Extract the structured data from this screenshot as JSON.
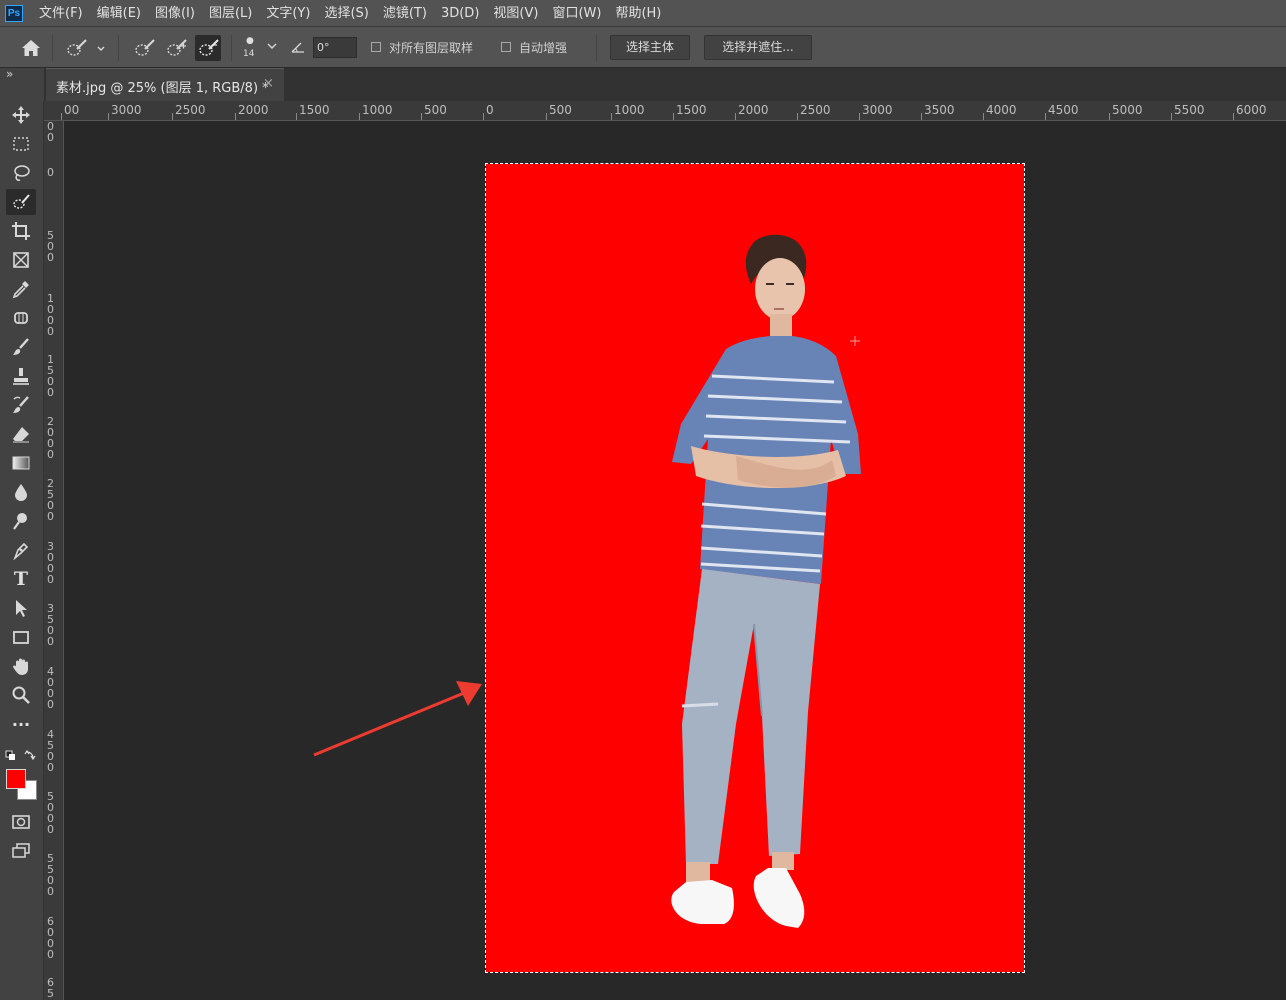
{
  "app": {
    "logo_text": "Ps",
    "accent_color": "#31a8ff"
  },
  "menu": {
    "items": [
      "文件(F)",
      "编辑(E)",
      "图像(I)",
      "图层(L)",
      "文字(Y)",
      "选择(S)",
      "滤镜(T)",
      "3D(D)",
      "视图(V)",
      "窗口(W)",
      "帮助(H)"
    ]
  },
  "options_bar": {
    "brush_size": "14",
    "angle_value": "0°",
    "sample_all_layers_label": "对所有图层取样",
    "sample_all_layers_checked": false,
    "auto_enhance_label": "自动增强",
    "auto_enhance_checked": false,
    "select_subject_label": "选择主体",
    "select_and_mask_label": "选择并遮住..."
  },
  "document_tab": {
    "title": "素材.jpg @ 25% (图层 1, RGB/8) *",
    "close_symbol": "×"
  },
  "panel_collapse_symbol": "»",
  "ruler_top": [
    "00",
    "3000",
    "2500",
    "2000",
    "1500",
    "1000",
    "500",
    "0",
    "500",
    "1000",
    "1500",
    "2000",
    "2500",
    "3000",
    "3500",
    "4000",
    "4500",
    "5000",
    "5500",
    "6000"
  ],
  "ruler_left": [
    "0\n0",
    "0",
    "5\n0\n0",
    "1\n0\n0\n0",
    "1\n5\n0\n0",
    "2\n0\n0\n0",
    "2\n5\n0\n0",
    "3\n0\n0\n0",
    "3\n5\n0\n0",
    "4\n0\n0\n0",
    "4\n5\n0\n0",
    "5\n0\n0\n0",
    "5\n5\n0\n0",
    "6\n0\n0\n0",
    "6\n5"
  ],
  "tools": [
    "move-tool",
    "marquee-tool",
    "lasso-tool",
    "quick-selection-tool",
    "crop-tool",
    "frame-tool",
    "eyedropper-tool",
    "spot-healing-tool",
    "brush-tool",
    "clone-stamp-tool",
    "history-brush-tool",
    "eraser-tool",
    "gradient-tool",
    "blur-tool",
    "dodge-tool",
    "pen-tool",
    "type-tool",
    "path-selection-tool",
    "rectangle-tool",
    "hand-tool",
    "zoom-tool",
    "more-tools"
  ],
  "active_tool": "quick-selection-tool",
  "type_tool_glyph": "T",
  "more_tools_glyph": "···",
  "colors": {
    "foreground": "#ff0000",
    "background": "#ffffff",
    "document_background": "#ff0000"
  }
}
